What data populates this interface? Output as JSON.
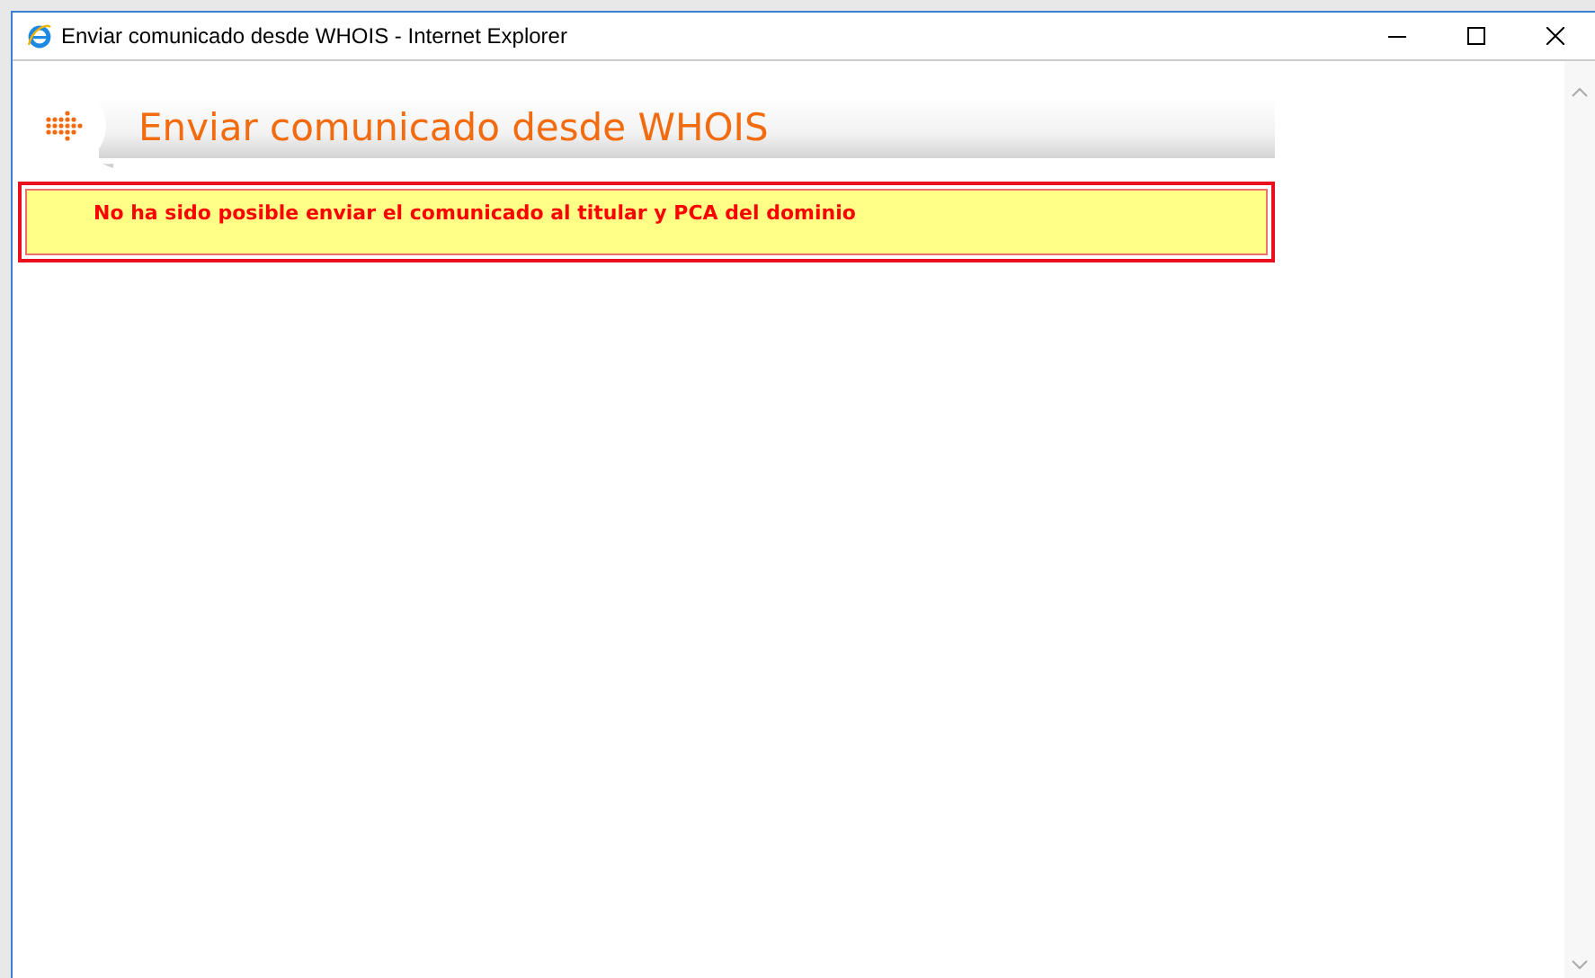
{
  "window": {
    "title": "Enviar comunicado desde WHOIS - Internet Explorer"
  },
  "page": {
    "heading": "Enviar comunicado desde WHOIS",
    "error_message": "No ha sido posible enviar el comunicado al titular y PCA del dominio"
  }
}
